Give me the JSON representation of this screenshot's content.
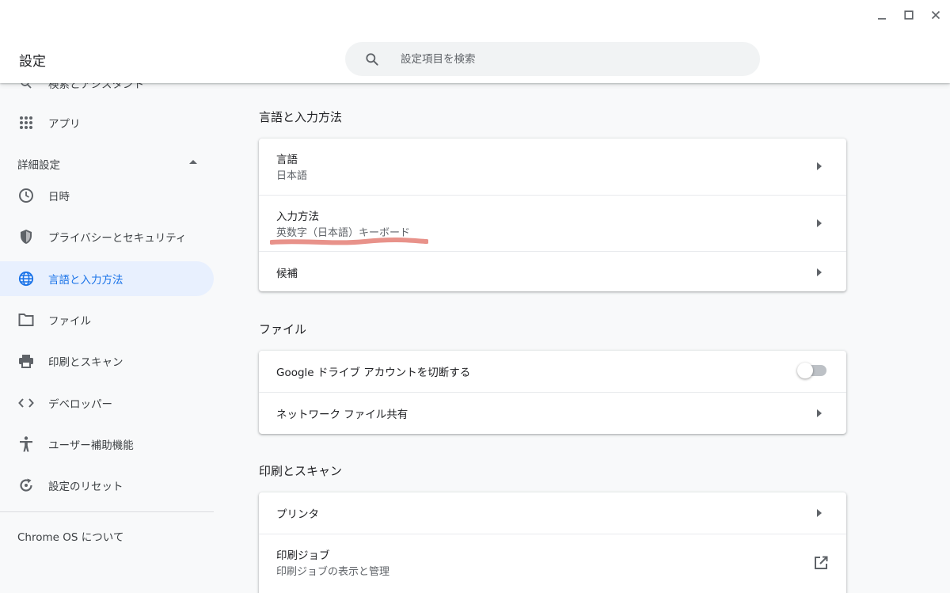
{
  "window": {
    "minimize_icon": "minimize-icon",
    "maximize_icon": "maximize-icon",
    "close_icon": "close-icon"
  },
  "header": {
    "title": "設定",
    "search": {
      "placeholder": "設定項目を検索",
      "value": ""
    }
  },
  "sidebar": {
    "partial_item": {
      "label": "検索とアシスタント",
      "icon": "search-icon"
    },
    "items_top": [
      {
        "label": "アプリ",
        "icon": "apps-grid-icon"
      }
    ],
    "advanced_section": {
      "label": "詳細設定",
      "expanded": true
    },
    "items_advanced": [
      {
        "label": "日時",
        "icon": "clock-icon"
      },
      {
        "label": "プライバシーとセキュリティ",
        "icon": "shield-icon"
      },
      {
        "label": "言語と入力方法",
        "icon": "globe-icon",
        "active": true
      },
      {
        "label": "ファイル",
        "icon": "folder-icon"
      },
      {
        "label": "印刷とスキャン",
        "icon": "printer-icon"
      },
      {
        "label": "デベロッパー",
        "icon": "code-icon"
      },
      {
        "label": "ユーザー補助機能",
        "icon": "accessibility-icon"
      },
      {
        "label": "設定のリセット",
        "icon": "reset-icon"
      }
    ],
    "about": "Chrome OS について"
  },
  "main": {
    "language_section": {
      "title": "言語と入力方法",
      "rows": [
        {
          "title": "言語",
          "subtitle": "日本語"
        },
        {
          "title": "入力方法",
          "subtitle": "英数字（日本語）キーボード"
        },
        {
          "title": "候補"
        }
      ]
    },
    "files_section": {
      "title": "ファイル",
      "rows": [
        {
          "title": "Google ドライブ アカウントを切断する",
          "toggle_on": false
        },
        {
          "title": "ネットワーク ファイル共有"
        }
      ]
    },
    "print_section": {
      "title": "印刷とスキャン",
      "rows": [
        {
          "title": "プリンタ"
        },
        {
          "title": "印刷ジョブ",
          "subtitle": "印刷ジョブの表示と管理"
        }
      ]
    }
  },
  "colors": {
    "accent": "#1a73e8",
    "active_bg": "#e8f0fe",
    "annotation_underline": "#e8928a"
  }
}
